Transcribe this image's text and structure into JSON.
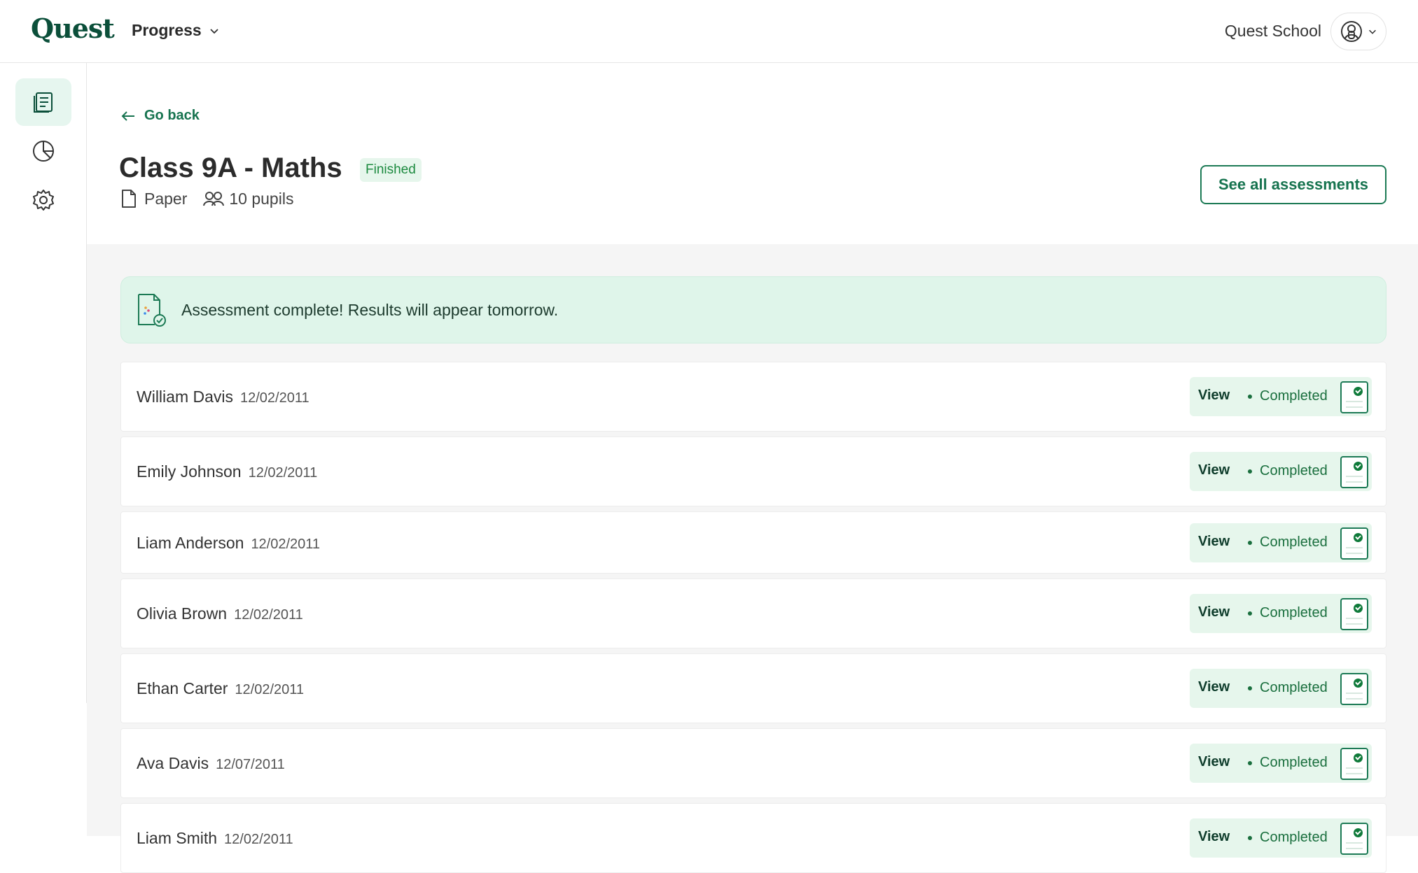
{
  "header": {
    "logo": "Quest",
    "nav_menu": "Progress",
    "school": "Quest School"
  },
  "sidebar": {
    "items": [
      {
        "icon": "assessments-icon",
        "active": true
      },
      {
        "icon": "pie-chart-icon",
        "active": false
      },
      {
        "icon": "settings-gear-icon",
        "active": false
      }
    ]
  },
  "page": {
    "go_back": "Go back",
    "title": "Class 9A - Maths",
    "status_badge": "Finished",
    "format": "Paper",
    "pupils": "10 pupils",
    "see_all": "See all assessments"
  },
  "banner": {
    "text": "Assessment complete! Results will appear tomorrow."
  },
  "pupils": [
    {
      "name": "William Davis",
      "dob": "12/02/2011",
      "view": "View",
      "status": "Completed"
    },
    {
      "name": "Emily Johnson",
      "dob": "12/02/2011",
      "view": "View",
      "status": "Completed"
    },
    {
      "name": "Liam Anderson",
      "dob": "12/02/2011",
      "view": "View",
      "status": "Completed"
    },
    {
      "name": "Olivia Brown",
      "dob": "12/02/2011",
      "view": "View",
      "status": "Completed"
    },
    {
      "name": "Ethan Carter",
      "dob": "12/02/2011",
      "view": "View",
      "status": "Completed"
    },
    {
      "name": "Ava Davis",
      "dob": "12/07/2011",
      "view": "View",
      "status": "Completed"
    },
    {
      "name": "Liam Smith",
      "dob": "12/02/2011",
      "view": "View",
      "status": "Completed"
    }
  ],
  "colors": {
    "brand": "#0b4f3a",
    "accent": "#16734f",
    "success_bg": "#e6f6ec",
    "banner_bg": "#dff5ea"
  }
}
